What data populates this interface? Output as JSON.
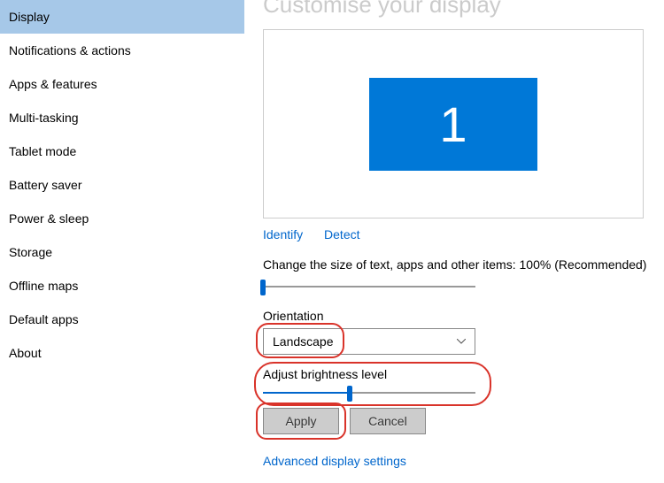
{
  "sidebar": {
    "items": [
      {
        "label": "Display",
        "active": true
      },
      {
        "label": "Notifications & actions"
      },
      {
        "label": "Apps & features"
      },
      {
        "label": "Multi-tasking"
      },
      {
        "label": "Tablet mode"
      },
      {
        "label": "Battery saver"
      },
      {
        "label": "Power & sleep"
      },
      {
        "label": "Storage"
      },
      {
        "label": "Offline maps"
      },
      {
        "label": "Default apps"
      },
      {
        "label": "About"
      }
    ]
  },
  "main": {
    "title": "Customise your display",
    "monitor_number": "1",
    "identify_label": "Identify",
    "detect_label": "Detect",
    "scale_label": "Change the size of text, apps and other items: 100% (Recommended)",
    "scale_slider_percent": 0,
    "orientation_label": "Orientation",
    "orientation_value": "Landscape",
    "brightness_label": "Adjust brightness level",
    "brightness_slider_percent": 41,
    "apply_label": "Apply",
    "cancel_label": "Cancel",
    "advanced_label": "Advanced display settings"
  }
}
